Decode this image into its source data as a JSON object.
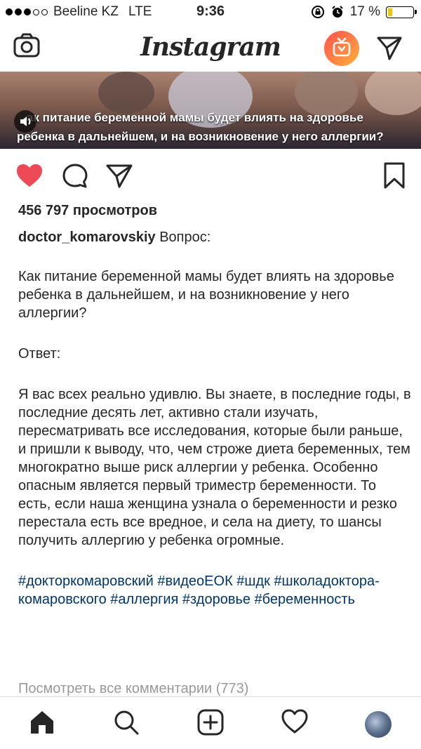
{
  "status": {
    "carrier": "Beeline KZ",
    "network": "LTE",
    "time": "9:36",
    "battery_text": "17 %",
    "battery_level": 0.17,
    "battery_color": "#f5c400"
  },
  "header": {
    "logo": "Instagram",
    "icons": [
      "camera-icon",
      "igtv-icon",
      "direct-message-icon"
    ],
    "igtv_gradient": [
      "#ff4f4f",
      "#ffb33a"
    ]
  },
  "video": {
    "caption_line1": "ак питание беременной мамы будет влиять на здоровье",
    "caption_line2": "ребенка в дальнейшем, и на возникновение у него аллергии?",
    "icon": "speaker-icon"
  },
  "actions": {
    "icons": [
      "heart-icon",
      "comment-icon",
      "share-icon",
      "bookmark-icon"
    ],
    "like_color": "#ed4956"
  },
  "post": {
    "views": "456 797 просмотров",
    "username": "doctor_komarovskiy",
    "first_line": " Вопрос:",
    "question": "Как питание беременной мамы будет влиять на здоровье ребенка в дальнейшем, и на возникновение у него аллергии?",
    "answer_label": "Ответ:",
    "answer": "Я вас всех реально удивлю. Вы знаете, в последние годы, в последние десять лет, активно стали изучать, пересматривать все исследования, которые были раньше, и пришли к выводу, что, чем строже диета беременных, тем многократно выше риск аллергии у ребенка. Особенно опасным является первый триместр беременности. То есть, если наша женщина узнала о беременности и резко перестала есть все вредное, и села на диету, то шансы получить аллергию у ребенка огромные.",
    "hashtags": "#докторкомаровский #видеоЕОК #шдк #школадоктора­комаровского #аллергия #здоровье #беременность",
    "hashtag_color": "#003569",
    "view_comments": "Посмотреть все комментарии (773)"
  },
  "tabbar": {
    "icons": [
      "home-icon",
      "search-icon",
      "add-post-icon",
      "activity-heart-icon",
      "profile-avatar"
    ]
  }
}
